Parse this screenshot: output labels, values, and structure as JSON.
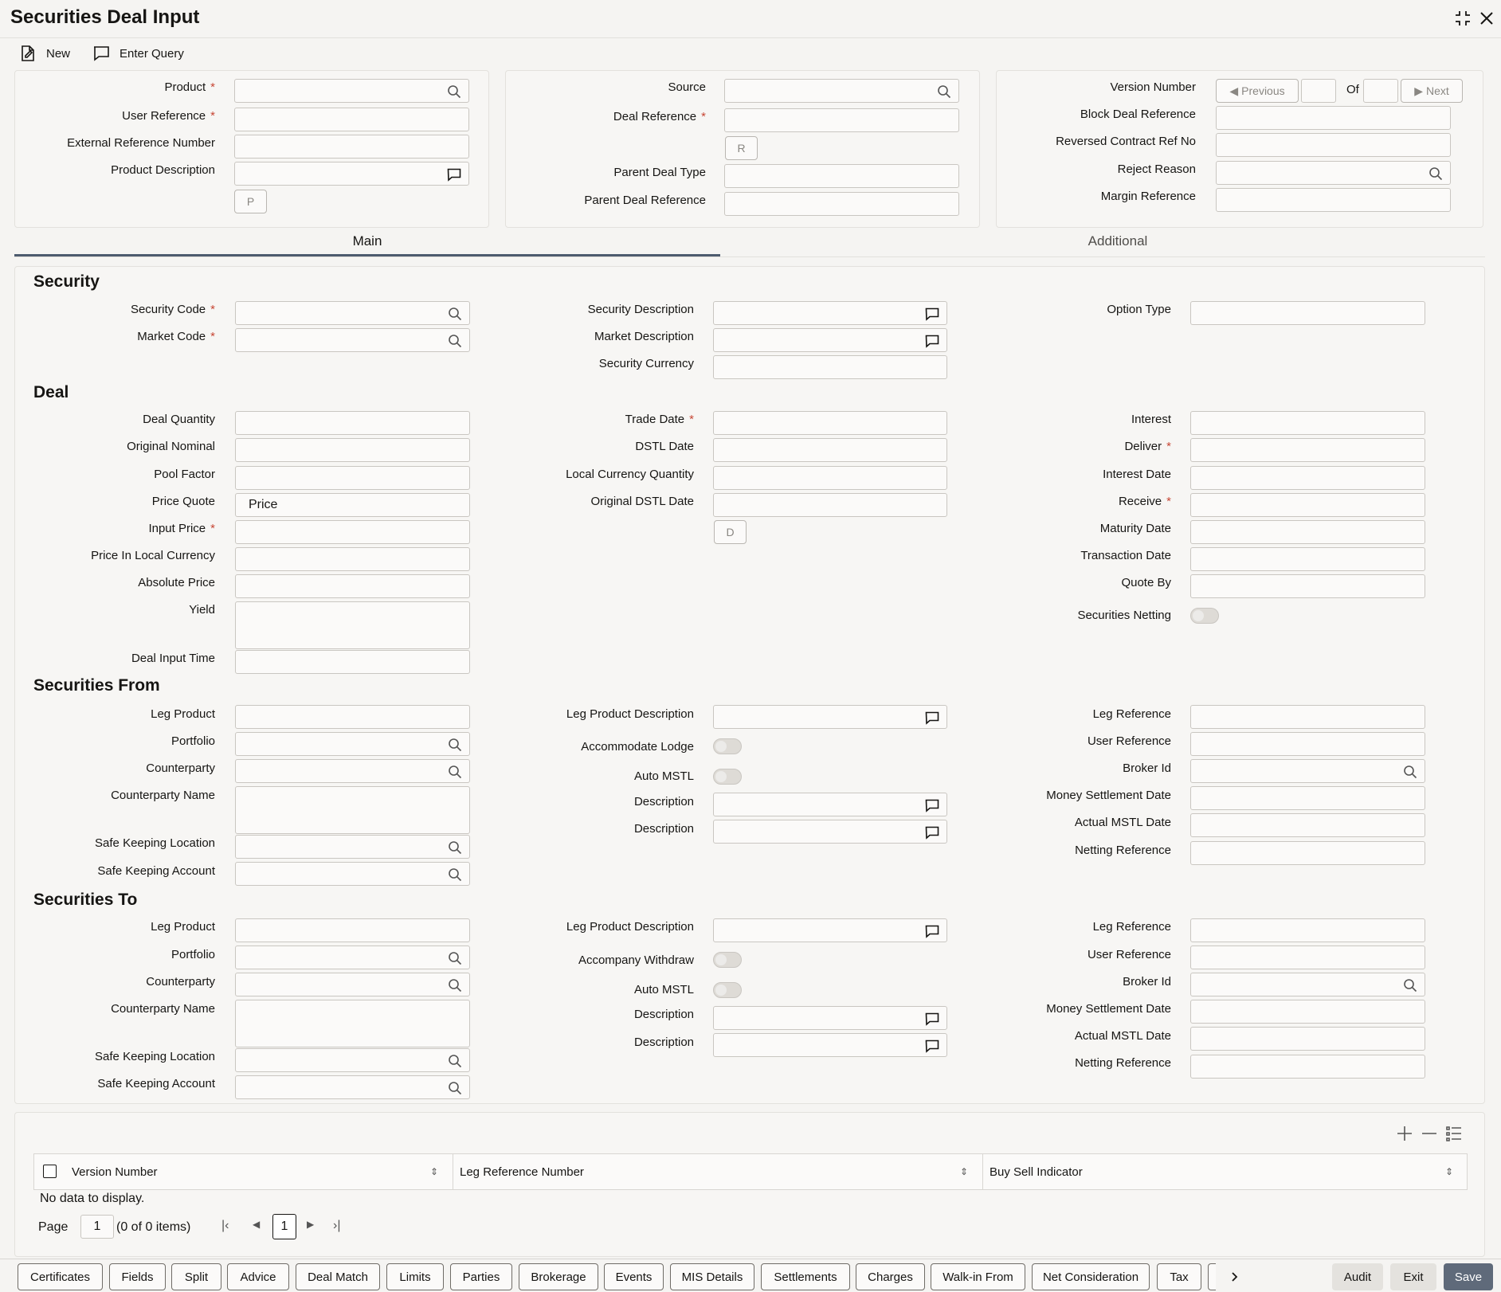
{
  "window": {
    "title": "Securities Deal Input"
  },
  "toolbar": {
    "new_label": "New",
    "enter_query_label": "Enter Query"
  },
  "header": {
    "product": {
      "label": "Product",
      "value": ""
    },
    "user_reference": {
      "label": "User Reference",
      "value": ""
    },
    "external_reference": {
      "label": "External Reference Number",
      "value": ""
    },
    "product_description": {
      "label": "Product Description",
      "value": ""
    },
    "p_button": "P",
    "source": {
      "label": "Source",
      "value": ""
    },
    "deal_reference": {
      "label": "Deal Reference",
      "value": ""
    },
    "r_button": "R",
    "parent_deal_type": {
      "label": "Parent Deal Type",
      "value": ""
    },
    "parent_deal_reference": {
      "label": "Parent Deal Reference",
      "value": ""
    },
    "version_number": {
      "label": "Version Number",
      "previous": "Previous",
      "of": "Of",
      "next": "Next"
    },
    "block_deal_reference": {
      "label": "Block Deal Reference",
      "value": ""
    },
    "reversed_contract": {
      "label": "Reversed Contract Ref No",
      "value": ""
    },
    "reject_reason": {
      "label": "Reject Reason",
      "value": ""
    },
    "margin_reference": {
      "label": "Margin Reference",
      "value": ""
    }
  },
  "tabs": [
    {
      "label": "Main",
      "active": true
    },
    {
      "label": "Additional",
      "active": false
    }
  ],
  "security": {
    "heading": "Security",
    "security_code": "Security Code",
    "market_code": "Market Code",
    "security_description": "Security Description",
    "market_description": "Market Description",
    "security_currency": "Security Currency",
    "option_type": "Option Type"
  },
  "deal": {
    "heading": "Deal",
    "deal_quantity": "Deal Quantity",
    "original_nominal": "Original Nominal",
    "pool_factor": "Pool Factor",
    "price_quote": "Price Quote",
    "price_quote_value": "Price",
    "input_price": "Input Price",
    "price_local": "Price In Local Currency",
    "absolute_price": "Absolute Price",
    "yield": "Yield",
    "deal_input_time": "Deal Input Time",
    "trade_date": "Trade Date",
    "dstl_date": "DSTL Date",
    "local_currency_quantity": "Local Currency Quantity",
    "original_dstl_date": "Original DSTL Date",
    "d_button": "D",
    "interest": "Interest",
    "deliver": "Deliver",
    "interest_date": "Interest Date",
    "receive": "Receive",
    "maturity_date": "Maturity Date",
    "transaction_date": "Transaction Date",
    "quote_by": "Quote By",
    "securities_netting": "Securities Netting"
  },
  "securities_from": {
    "heading": "Securities From",
    "leg_product": "Leg Product",
    "portfolio": "Portfolio",
    "counterparty": "Counterparty",
    "counterparty_name": "Counterparty Name",
    "safe_keeping_location": "Safe Keeping Location",
    "safe_keeping_account": "Safe Keeping Account",
    "leg_product_description": "Leg Product Description",
    "accommodate": "Accommodate Lodge",
    "auto_mstl": "Auto MSTL",
    "description1": "Description",
    "description2": "Description",
    "leg_reference": "Leg Reference",
    "user_reference": "User Reference",
    "broker_id": "Broker Id",
    "money_settlement_date": "Money Settlement Date",
    "actual_mstl_date": "Actual MSTL Date",
    "netting_reference": "Netting Reference"
  },
  "securities_to": {
    "heading": "Securities To",
    "leg_product": "Leg Product",
    "portfolio": "Portfolio",
    "counterparty": "Counterparty",
    "counterparty_name": "Counterparty Name",
    "safe_keeping_location": "Safe Keeping Location",
    "safe_keeping_account": "Safe Keeping Account",
    "leg_product_description": "Leg Product Description",
    "accommodate": "Accompany Withdraw",
    "auto_mstl": "Auto MSTL",
    "description1": "Description",
    "description2": "Description",
    "leg_reference": "Leg Reference",
    "user_reference": "User Reference",
    "broker_id": "Broker Id",
    "money_settlement_date": "Money Settlement Date",
    "actual_mstl_date": "Actual MSTL Date",
    "netting_reference": "Netting Reference"
  },
  "grid": {
    "columns": [
      "Version Number",
      "Leg Reference Number",
      "Buy Sell Indicator"
    ],
    "empty_text": "No data to display.",
    "page_label": "Page",
    "page_value": "1",
    "items_text": "(0 of 0 items)",
    "current_page": "1"
  },
  "footer": {
    "buttons": [
      "Certificates",
      "Fields",
      "Split",
      "Advice",
      "Deal Match",
      "Limits",
      "Parties",
      "Brokerage",
      "Events",
      "MIS Details",
      "Settlements",
      "Charges",
      "Walk-in From",
      "Net Consideration",
      "Tax"
    ],
    "audit": "Audit",
    "exit": "Exit",
    "save": "Save"
  }
}
